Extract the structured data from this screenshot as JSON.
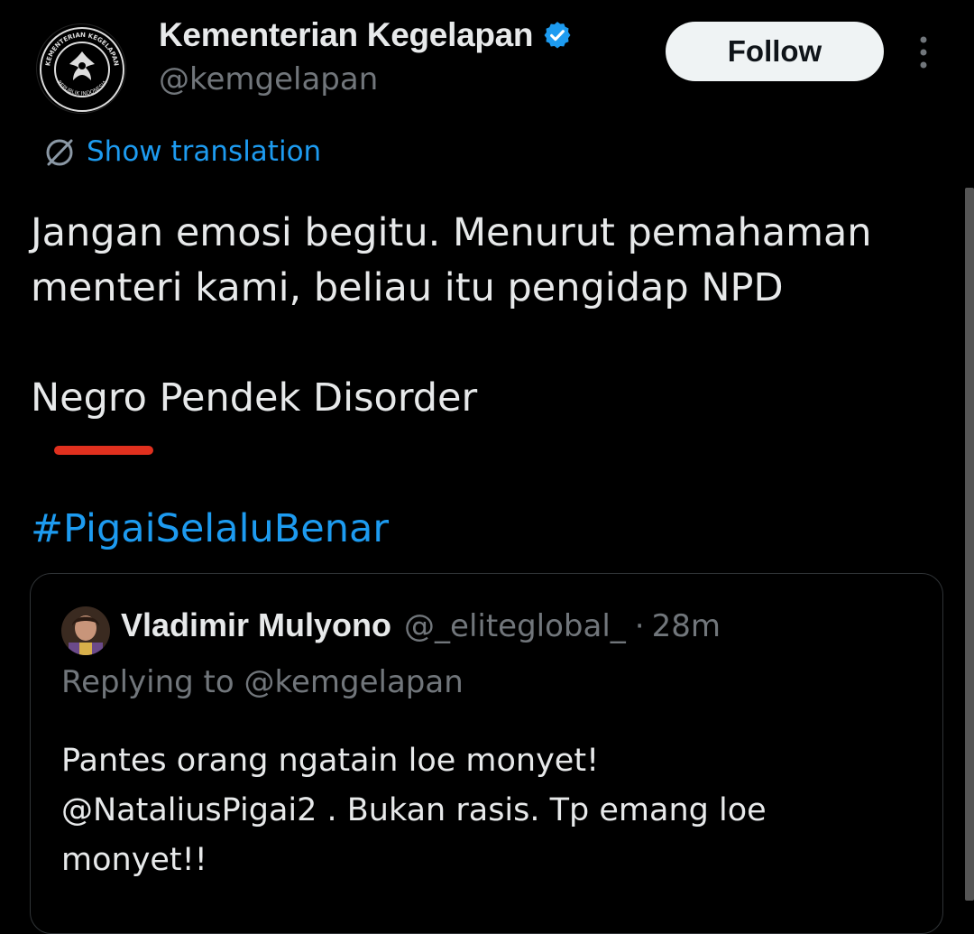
{
  "author": {
    "display_name": "Kementerian Kegelapan",
    "handle": "@kemgelapan",
    "verified": true,
    "avatar_ring_text_top": "KEMENTERIAN KEGELAPAN",
    "avatar_ring_text_bottom": "REPUBLIK INDONESIA"
  },
  "actions": {
    "follow_label": "Follow",
    "more_icon": "more-vertical-icon"
  },
  "translation": {
    "label": "Show translation",
    "icon": "globe-icon"
  },
  "tweet": {
    "text": "Jangan emosi begitu. Menurut pemahaman\nmenteri kami, beliau itu pengidap NPD\n\nNegro Pendek Disorder",
    "hashtag": "#PigaiSelaluBenar"
  },
  "quoted_tweet": {
    "display_name": "Vladimir Mulyono",
    "handle": "@_eliteglobal_",
    "separator": "·",
    "time": "28m",
    "replying_prefix": "Replying to",
    "replying_handle": "@kemgelapan",
    "text": "Pantes orang ngatain loe monyet!\n@NataliusPigai2 . Bukan rasis. Tp emang loe\nmonyet!!"
  },
  "colors": {
    "background": "#000000",
    "text": "#e7e9ea",
    "muted": "#71767b",
    "link": "#1d9bf0",
    "verified": "#1d9bf0",
    "annotation_underline": "#e0301e",
    "follow_bg": "#eff3f4"
  }
}
